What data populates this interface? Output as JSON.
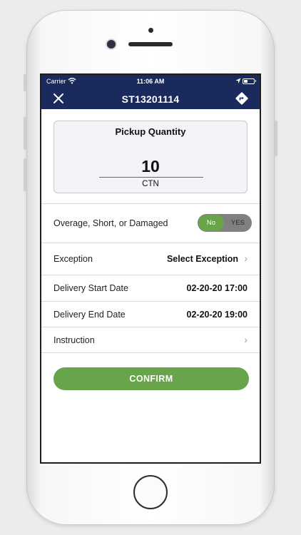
{
  "status_bar": {
    "carrier": "Carrier",
    "time": "11:06 AM",
    "battery_level": 0.4
  },
  "nav": {
    "title": "ST13201114",
    "close_icon": "close-icon",
    "directions_icon": "directions-icon"
  },
  "pickup": {
    "title": "Pickup Quantity",
    "value": "10",
    "unit": "CTN"
  },
  "osd": {
    "label": "Overage, Short, or Damaged",
    "toggle_no": "No",
    "toggle_yes": "YES",
    "selected": "No"
  },
  "exception": {
    "label": "Exception",
    "value": "Select Exception"
  },
  "delivery_start": {
    "label": "Delivery Start Date",
    "value": "02-20-20 17:00"
  },
  "delivery_end": {
    "label": "Delivery End Date",
    "value": "02-20-20 19:00"
  },
  "instruction": {
    "label": "Instruction"
  },
  "confirm_label": "CONFIRM",
  "colors": {
    "navbar": "#1b2a5c",
    "accent_green": "#67a44a",
    "toggle_off": "#808080"
  }
}
